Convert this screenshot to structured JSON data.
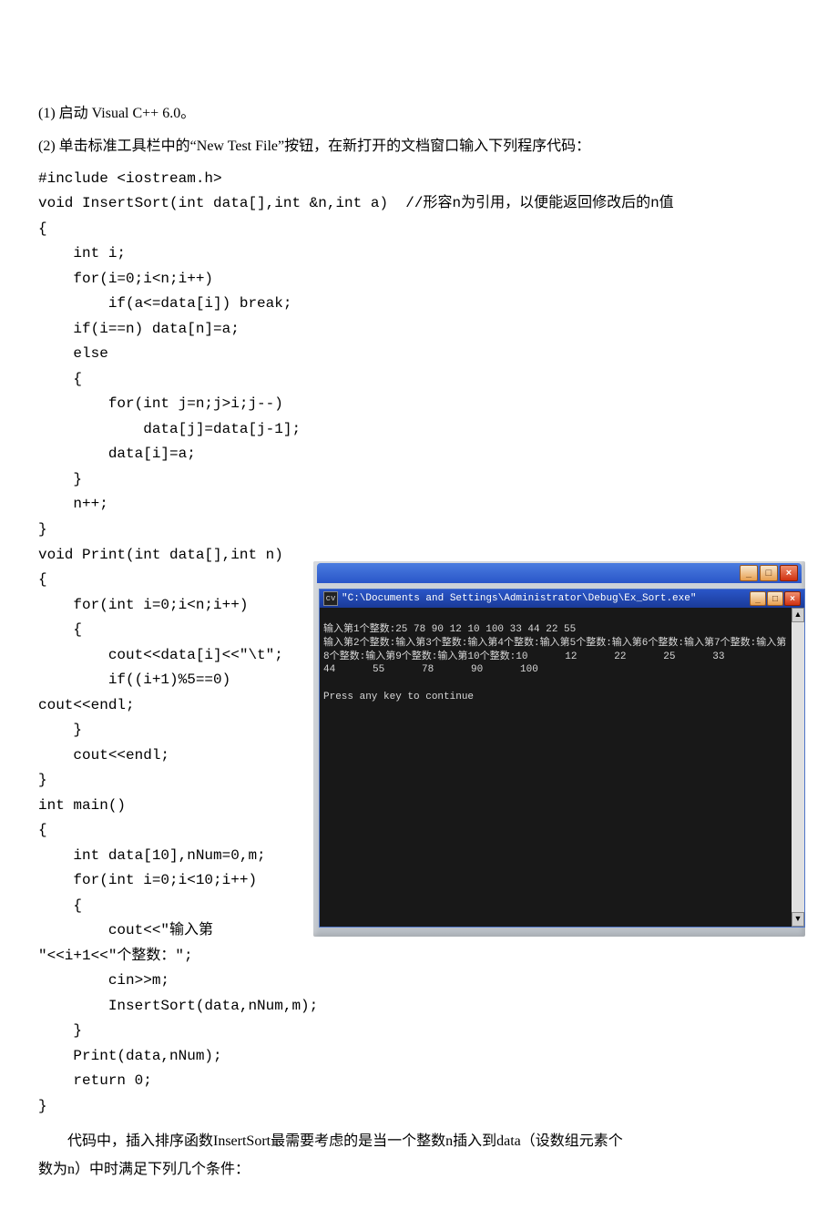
{
  "para1_prefix": "(1) 启动 ",
  "para1_roman": "Visual C++ 6.0",
  "para1_suffix": "。",
  "para2_prefix": "(2) 单击标准工具栏中的“",
  "para2_roman": "New Test File",
  "para2_suffix": "”按钮，在新打开的文档窗口输入下列程序代码：",
  "code": "#include <iostream.h>\nvoid InsertSort(int data[],int &n,int a)  //形容n为引用，以便能返回修改后的n值\n{\n    int i;\n    for(i=0;i<n;i++)\n        if(a<=data[i]) break;\n    if(i==n) data[n]=a;\n    else\n    {\n        for(int j=n;j>i;j--)\n            data[j]=data[j-1];\n        data[i]=a;\n    }\n    n++;\n}\nvoid Print(int data[],int n)\n{\n    for(int i=0;i<n;i++)\n    {\n        cout<<data[i]<<\"\\t\";\n        if((i+1)%5==0)\ncout<<endl;\n    }\n    cout<<endl;\n}\nint main()\n{\n    int data[10],nNum=0,m;\n    for(int i=0;i<10;i++)\n    {\n        cout<<\"输入第\n\"<<i+1<<\"个整数：\";\n        cin>>m;\n        InsertSort(data,nNum,m);\n    }\n    Print(data,nNum);\n    return 0;\n}",
  "console": {
    "outer_min": "_",
    "outer_max": "□",
    "outer_close": "×",
    "inner_icon": "cv",
    "inner_title": "\"C:\\Documents and Settings\\Administrator\\Debug\\Ex_Sort.exe\"",
    "inner_min": "_",
    "inner_max": "□",
    "inner_close": "×",
    "line1": "输入第1个整数:25 78 90 12 10 100 33 44 22 55",
    "line2": "输入第2个整数:输入第3个整数:输入第4个整数:输入第5个整数:输入第6个整数:输入第7个整数:输入第8个整数:输入第9个整数:输入第10个整数:",
    "nums_row1": [
      "10",
      "12",
      "22",
      "25",
      "33"
    ],
    "nums_row2": [
      "44",
      "55",
      "78",
      "90",
      "100"
    ],
    "press": "Press any key to continue",
    "scroll_up": "▲",
    "scroll_down": "▼"
  },
  "explain1": "代码中，插入排序函数InsertSort最需要考虑的是当一个整数n插入到data（设数组元素个",
  "explain2": "数为n）中时满足下列几个条件："
}
